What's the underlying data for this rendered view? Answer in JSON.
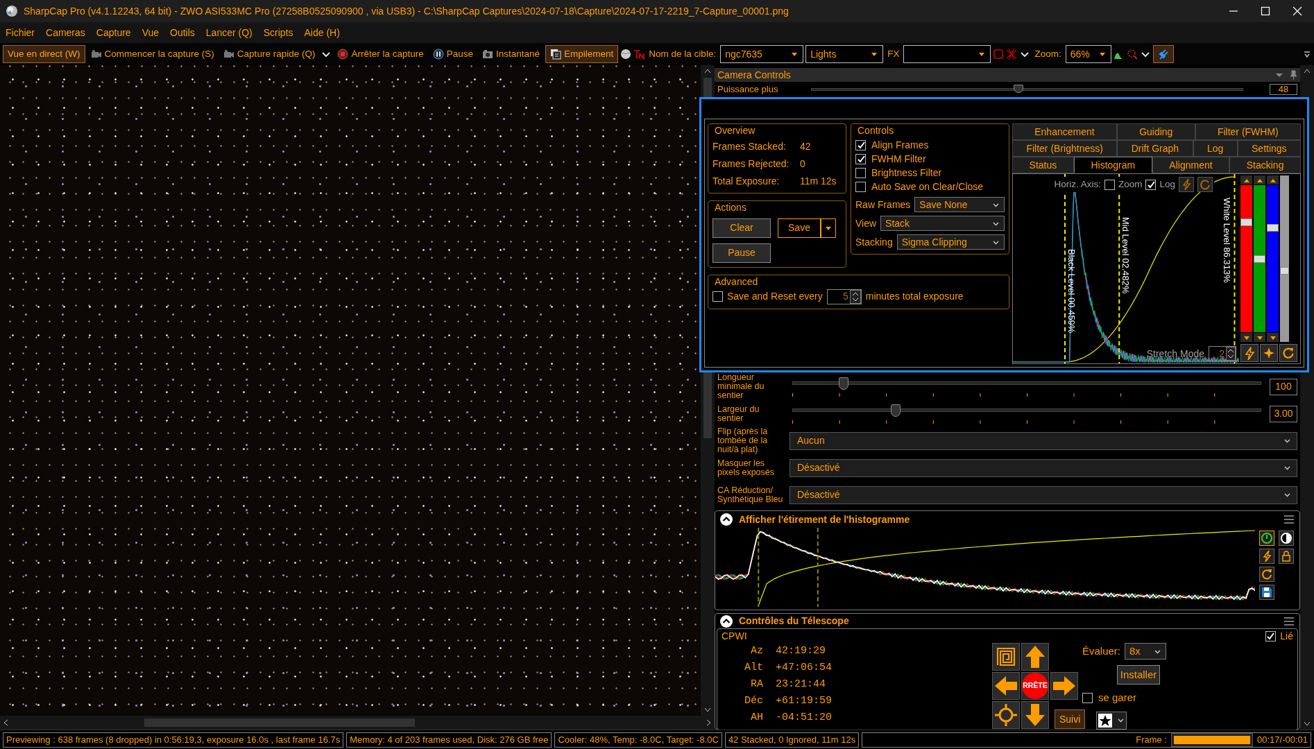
{
  "window": {
    "title": "SharpCap Pro (v4.1.12243, 64 bit) - ZWO ASI533MC Pro (27258B0525090900 , via USB3) - C:\\SharpCap Captures\\2024-07-18\\Capture\\2024-07-17-2219_7-Capture_00001.png"
  },
  "menu": [
    "Fichier",
    "Cameras",
    "Capture",
    "Vue",
    "Outils",
    "Lancer (Q)",
    "Scripts",
    "Aide (H)"
  ],
  "toolbar": {
    "live_view": {
      "label": "Vue en direct (W)",
      "active": true
    },
    "start_capture": "Commencer la capture (S)",
    "quick_capture": "Capture rapide (Q)",
    "stop_capture": "Arrêter la capture",
    "pause": "Pause",
    "snapshot": "Instantané",
    "stacking": {
      "label": "Empilement",
      "active": true
    },
    "target_label": "Nom de la cible:",
    "target": "ngc7635",
    "frame_type": "Lights",
    "fx_label": "FX",
    "zoom_label": "Zoom:",
    "zoom": "66%",
    "plug_active": true
  },
  "camera_controls": {
    "title": "Camera Controls",
    "rows_above": [
      {
        "kind": "slider",
        "label": "Puissance plus",
        "value": "48",
        "level": 0.48
      }
    ],
    "rows_below": [
      {
        "kind": "slider",
        "label": "Longueur minimale du sentier",
        "value": "100",
        "level": 0.11
      },
      {
        "kind": "slider",
        "label": "Largeur du sentier",
        "value": "3.00",
        "level": 0.22
      },
      {
        "kind": "select",
        "label": "Flip (après la tombée de la nuit/à plat)",
        "value": "Aucun"
      },
      {
        "kind": "select",
        "label": "Masquer les pixels exposés",
        "value": "Désactivé"
      },
      {
        "kind": "select",
        "label": "CA Réduction/ Synthétique Bleu",
        "value": "Désactivé"
      }
    ]
  },
  "stacking": {
    "overview": {
      "title": "Overview",
      "rows": [
        {
          "label": "Frames Stacked:",
          "value": "42"
        },
        {
          "label": "Frames Rejected:",
          "value": "0"
        },
        {
          "label": "Total Exposure:",
          "value": "11m 12s"
        }
      ]
    },
    "actions": {
      "title": "Actions",
      "clear": "Clear",
      "save": "Save",
      "pause": "Pause"
    },
    "controls": {
      "title": "Controls",
      "checks": [
        {
          "label": "Align Frames",
          "checked": true
        },
        {
          "label": "FWHM Filter",
          "checked": true
        },
        {
          "label": "Brightness Filter",
          "checked": false
        },
        {
          "label": "Auto Save on Clear/Close",
          "checked": false
        }
      ],
      "selects": [
        {
          "label": "Raw Frames",
          "value": "Save None"
        },
        {
          "label": "View",
          "value": "Stack"
        },
        {
          "label": "Stacking",
          "value": "Sigma Clipping"
        }
      ]
    },
    "advanced": {
      "title": "Advanced",
      "checked": false,
      "label": "Save and Reset every",
      "value": "5",
      "unit": "minutes total exposure"
    },
    "tab_rows": [
      {
        "tabs": [
          {
            "label": "Enhancement",
            "selected": false
          },
          {
            "label": "Guiding",
            "selected": false
          },
          {
            "label": "Filter (FWHM)",
            "selected": false
          }
        ]
      },
      {
        "tabs": [
          {
            "label": "Filter (Brightness)",
            "selected": false
          },
          {
            "label": "Drift Graph",
            "selected": false
          },
          {
            "label": "Log",
            "selected": false
          },
          {
            "label": "Settings",
            "selected": false
          }
        ]
      },
      {
        "tabs": [
          {
            "label": "Status",
            "selected": false
          },
          {
            "label": "Histogram",
            "selected": true
          },
          {
            "label": "Alignment",
            "selected": false
          },
          {
            "label": "Stacking",
            "selected": false
          }
        ]
      }
    ],
    "histogram": {
      "axis_label": "Horiz. Axis:",
      "zoom": {
        "label": "Zoom",
        "checked": false
      },
      "log": {
        "label": "Log",
        "checked": true
      },
      "black_level": "Black Level 00.459%",
      "mid_level": "Mid Level 02.482%",
      "white_level": "White Level 86.313%",
      "stretch_label": "Stretch Mode",
      "stretch_value": "2",
      "channels": [
        {
          "color": "#ff0000",
          "level": 0.75
        },
        {
          "color": "#00a000",
          "level": 0.5
        },
        {
          "color": "#0000ff",
          "level": 0.71
        },
        {
          "color": "#9a9a9a",
          "level": 0.43
        }
      ]
    }
  },
  "stretch": {
    "title": "Afficher l'étirement de l'histogramme"
  },
  "telescope": {
    "title": "Contrôles du Télescope",
    "mount": "CPWI",
    "linked": {
      "label": "Lié",
      "checked": true
    },
    "coords": [
      {
        "label": "Az",
        "value": "42:19:29"
      },
      {
        "label": "Alt",
        "value": "+47:06:54"
      },
      {
        "label": "RA",
        "value": "23:21:44"
      },
      {
        "label": "Déc",
        "value": "+61:19:59"
      },
      {
        "label": "AH",
        "value": "-04:51:20"
      }
    ],
    "stop": "RRÊTE",
    "tracking": {
      "label": "Suivi",
      "active": true
    },
    "rate_label": "Évaluer:",
    "rate": "8x",
    "setup": "Installer",
    "park": {
      "label": "se garer",
      "checked": false
    }
  },
  "status_bar": {
    "preview": "Previewing : 638 frames (8 dropped) in 0:56:19,3, exposure 16.0s , last frame 16.7s",
    "memory": "Memory: 4 of 203 frames used, Disk: 276 GB free",
    "cooler": "Cooler: 48%, Temp: -8.0C, Target: -8.0C",
    "stacked": "42 Stacked, 0 Ignored, 11m 12s",
    "frame_label": "Frame :",
    "frame_progress": {
      "level": 1
    },
    "time": "00:17/-00:01"
  }
}
